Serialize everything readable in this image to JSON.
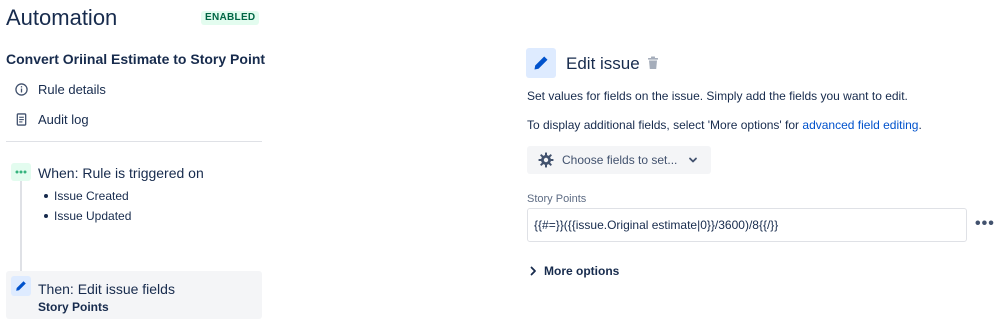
{
  "header": {
    "title": "Automation",
    "status": "ENABLED"
  },
  "rule": {
    "name": "Convert Oriinal Estimate to Story Point"
  },
  "sidebar": {
    "links": [
      {
        "label": "Rule details",
        "icon": "info-icon"
      },
      {
        "label": "Audit log",
        "icon": "document-icon"
      }
    ]
  },
  "trigger": {
    "title": "When: Rule is triggered on",
    "items": [
      "Issue Created",
      "Issue Updated"
    ],
    "icon": "ellipsis-icon"
  },
  "action": {
    "title": "Then: Edit issue fields",
    "subtitle": "Story Points",
    "icon": "pencil-icon"
  },
  "editor": {
    "title": "Edit issue",
    "description": "Set values for fields on the issue. Simply add the fields you want to edit.",
    "hint_prefix": "To display additional fields, select 'More options' for ",
    "hint_link": "advanced field editing",
    "hint_suffix": ".",
    "choose_label": "Choose fields to set...",
    "field_label": "Story Points",
    "field_value": "{{#=}}({{issue.Original estimate|0}}/3600)/8{{/}}",
    "more_options_label": "More options"
  },
  "colors": {
    "enabled_badge_bg": "#e3fcef",
    "enabled_badge_text": "#006644",
    "link": "#0052cc",
    "icon_blue": "#0052cc",
    "trigger_green": "#36b37e"
  }
}
